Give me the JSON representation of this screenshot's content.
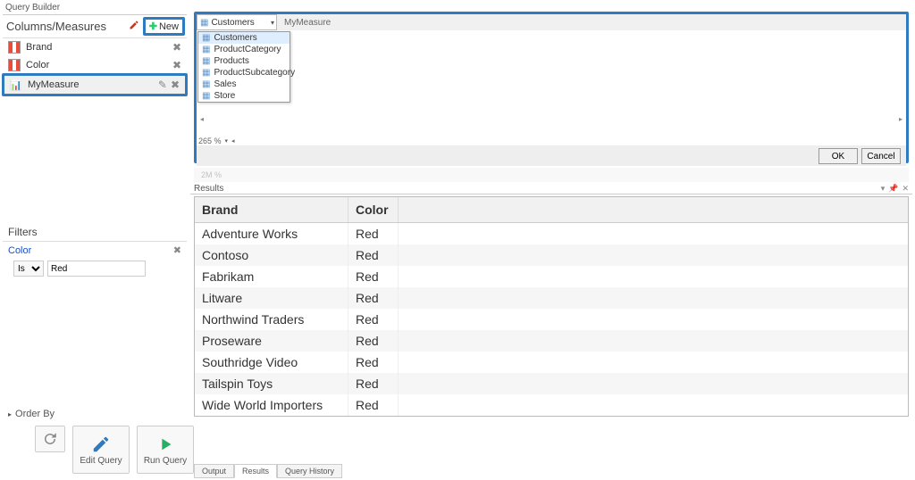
{
  "left": {
    "query_builder_title": "Query Builder",
    "columns_title": "Columns/Measures",
    "new_label": "New",
    "columns": [
      {
        "label": "Brand",
        "type": "dimension"
      },
      {
        "label": "Color",
        "type": "dimension"
      },
      {
        "label": "MyMeasure",
        "type": "measure",
        "selected": true
      }
    ],
    "filters_title": "Filters",
    "filter_field": "Color",
    "filter_op": "Is",
    "filter_value": "Red",
    "orderby_title": "Order By",
    "edit_query_label": "Edit Query",
    "run_query_label": "Run Query"
  },
  "editor": {
    "table_selected": "Customers",
    "measure_name": "MyMeasure",
    "dropdown_items": [
      "Customers",
      "ProductCategory",
      "Products",
      "ProductSubcategory",
      "Sales",
      "Store"
    ],
    "zoom_label": "265 %",
    "ok_label": "OK",
    "cancel_label": "Cancel",
    "ghost_zoom": "2M %"
  },
  "results": {
    "title": "Results",
    "headers": [
      "Brand",
      "Color"
    ],
    "rows": [
      {
        "brand": "Adventure Works",
        "color": "Red"
      },
      {
        "brand": "Contoso",
        "color": "Red"
      },
      {
        "brand": "Fabrikam",
        "color": "Red"
      },
      {
        "brand": "Litware",
        "color": "Red"
      },
      {
        "brand": "Northwind Traders",
        "color": "Red"
      },
      {
        "brand": "Proseware",
        "color": "Red"
      },
      {
        "brand": "Southridge Video",
        "color": "Red"
      },
      {
        "brand": "Tailspin Toys",
        "color": "Red"
      },
      {
        "brand": "Wide World Importers",
        "color": "Red"
      }
    ]
  },
  "bottom_tabs": {
    "output": "Output",
    "results": "Results",
    "history": "Query History"
  }
}
